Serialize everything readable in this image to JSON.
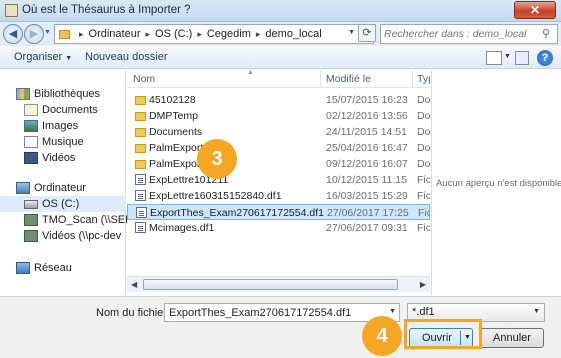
{
  "window": {
    "title": "Où est le Thésaurus à Importer ?",
    "close_label": "✕"
  },
  "address": {
    "crumbs": [
      "Ordinateur",
      "OS (C:)",
      "Cegedim",
      "demo_local"
    ],
    "separator": "▸"
  },
  "search": {
    "placeholder": "Rechercher dans : demo_local"
  },
  "toolbar": {
    "organiser": "Organiser",
    "new_folder": "Nouveau dossier"
  },
  "nav": {
    "items": [
      {
        "label": "Bibliothèques",
        "icon": "library-icon"
      },
      {
        "label": "Documents",
        "icon": "documents-icon"
      },
      {
        "label": "Images",
        "icon": "images-icon"
      },
      {
        "label": "Musique",
        "icon": "music-icon"
      },
      {
        "label": "Vidéos",
        "icon": "videos-icon"
      },
      {
        "label": "Ordinateur",
        "icon": "computer-icon"
      },
      {
        "label": "OS (C:)",
        "icon": "disk-icon"
      },
      {
        "label": "TMO_Scan (\\\\SEF",
        "icon": "network-drive-icon"
      },
      {
        "label": "Vidéos (\\\\pc-dev",
        "icon": "network-drive-icon"
      },
      {
        "label": "Réseau",
        "icon": "network-icon"
      }
    ]
  },
  "columns": {
    "name": "Nom",
    "date": "Modifié le",
    "type": "Typ"
  },
  "files": [
    {
      "name": "45102128",
      "date": "15/07/2015 16:23",
      "type": "Do",
      "kind": "folder"
    },
    {
      "name": "DMPTemp",
      "date": "02/12/2016 13:56",
      "type": "Do",
      "kind": "folder"
    },
    {
      "name": "Documents",
      "date": "24/11/2015 14:51",
      "type": "Do",
      "kind": "folder"
    },
    {
      "name": "PalmExport_1",
      "date": "25/04/2016 16:47",
      "type": "Do",
      "kind": "folder"
    },
    {
      "name": "PalmExport_",
      "date": "09/12/2016 16:07",
      "type": "Do",
      "kind": "folder"
    },
    {
      "name": "ExpLettre101211",
      "date": "10/12/2015 11:15",
      "type": "Fic",
      "kind": "file"
    },
    {
      "name": "ExpLettre160315152840.df1",
      "date": "16/03/2015 15:29",
      "type": "Fic",
      "kind": "file"
    },
    {
      "name": "ExportThes_Exam270617172554.df1",
      "date": "27/06/2017 17:25",
      "type": "Fic",
      "kind": "file",
      "selected": true
    },
    {
      "name": "Mcimages.df1",
      "date": "27/06/2017 09:31",
      "type": "Fic",
      "kind": "file"
    }
  ],
  "preview": {
    "message": "Aucun aperçu n'est disponible."
  },
  "footer": {
    "filename_label": "Nom du fichier :",
    "filename_value": "ExportThes_Exam270617172554.df1",
    "filter_value": "*.df1",
    "open_label": "Ouvrir",
    "cancel_label": "Annuler"
  },
  "callouts": [
    "3",
    "4"
  ],
  "colors": {
    "callout": "#f5a623",
    "selection": "#cde6fb"
  }
}
